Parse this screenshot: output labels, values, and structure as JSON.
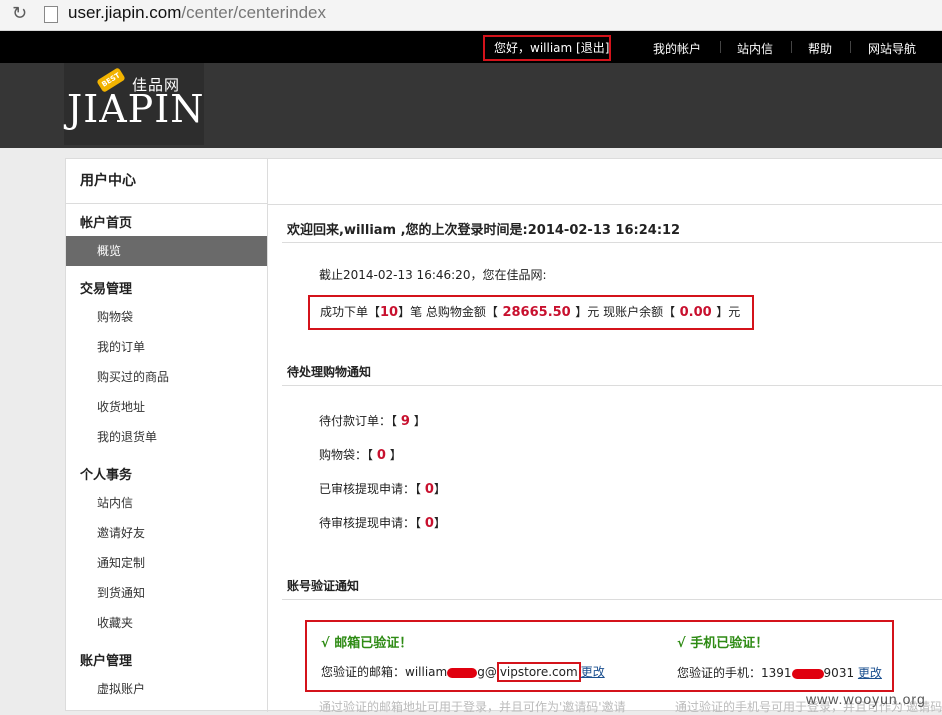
{
  "browser": {
    "url_domain": "user.jiapin.com",
    "url_path": "/center/centerindex"
  },
  "topnav": {
    "greeting": "您好，william [退出]",
    "links": [
      "我的帐户",
      "站内信",
      "帮助",
      "网站导航"
    ]
  },
  "logo": {
    "badge": "BEST",
    "chinese": "佳品网",
    "english": "JIAPIN"
  },
  "sidebar": {
    "title": "用户中心",
    "sections": [
      {
        "heading": "帐户首页",
        "items": [
          "概览"
        ]
      },
      {
        "heading": "交易管理",
        "items": [
          "购物袋",
          "我的订单",
          "购买过的商品",
          "收货地址",
          "我的退货单"
        ]
      },
      {
        "heading": "个人事务",
        "items": [
          "站内信",
          "邀请好友",
          "通知定制",
          "到货通知",
          "收藏夹"
        ]
      },
      {
        "heading": "账户管理",
        "items": [
          "虚拟账户"
        ]
      }
    ],
    "active_item": "概览"
  },
  "content": {
    "welcome": "欢迎回来,william ,您的上次登录时间是:2014-02-13 16:24:12",
    "as_of": "截止2014-02-13 16:46:20，您在佳品网:",
    "summary": {
      "orders_prefix": "成功下单【",
      "orders": "10",
      "orders_suffix": "】笔 总购物金额【",
      "total": "28665.50",
      "total_suffix": "】元 现账户余额【",
      "balance": "0.00",
      "balance_suffix": "】元"
    },
    "pending_heading": "待处理购物通知",
    "pending": [
      {
        "label": "待付款订单：【",
        "value": "9",
        "end": "】"
      },
      {
        "label": "购物袋：【",
        "value": "0",
        "end": "】"
      },
      {
        "label": "已审核提现申请：【",
        "value": "0",
        "end": "】"
      },
      {
        "label": "待审核提现申请：【",
        "value": "0",
        "end": "】"
      }
    ],
    "verify_heading": "账号验证通知",
    "email": {
      "status": "√ 邮箱已验证！",
      "label": "您验证的邮箱：william",
      "masked_tail": "g@",
      "domain": "vipstore.com",
      "change": "更改",
      "note": "通过验证的邮箱地址可用于登录，并且可作为'邀请码'邀请"
    },
    "phone": {
      "status": "√ 手机已验证！",
      "label": "您验证的手机：1391",
      "tail": "9031",
      "change": "更改",
      "note": "通过验证的手机号可用于登录，并且可作为'邀请码'"
    }
  },
  "watermark": "www.wooyun.org"
}
